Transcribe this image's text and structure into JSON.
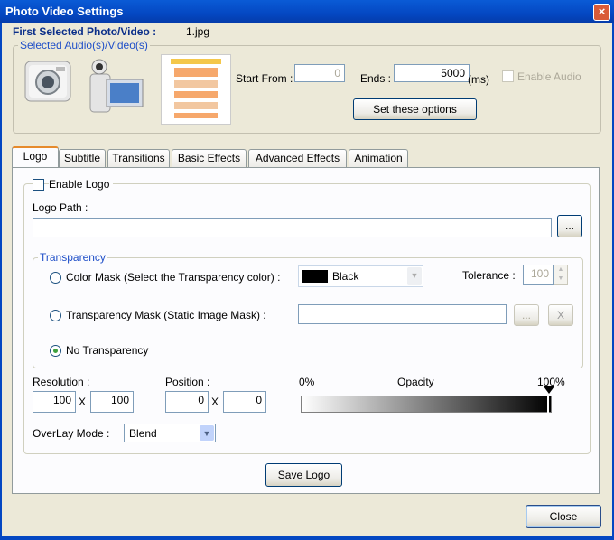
{
  "window": {
    "title": "Photo Video Settings"
  },
  "header": {
    "first_selected_label": "First Selected Photo/Video :",
    "first_selected_value": "1.jpg",
    "selected_group_label": "Selected Audio(s)/Video(s)",
    "start_from_label": "Start From :",
    "start_from_value": "0",
    "ends_label": "Ends :",
    "ends_value": "5000",
    "ends_unit": "(ms)",
    "enable_audio_label": "Enable Audio",
    "set_options_label": "Set these options"
  },
  "tabs": [
    {
      "label": "Logo"
    },
    {
      "label": "Subtitle"
    },
    {
      "label": "Transitions"
    },
    {
      "label": "Basic Effects"
    },
    {
      "label": "Advanced Effects"
    },
    {
      "label": "Animation"
    }
  ],
  "logo": {
    "enable_logo_label": "Enable Logo",
    "logo_path_label": "Logo Path :",
    "logo_path_value": "",
    "browse_label": "...",
    "transparency_label": "Transparency",
    "color_mask_label": "Color Mask (Select the Transparency color) :",
    "color_value": "Black",
    "tolerance_label": "Tolerance :",
    "tolerance_value": "100",
    "transparency_mask_label": "Transparency Mask (Static Image Mask) :",
    "mask_path_value": "",
    "mask_browse_label": "...",
    "mask_clear_label": "X",
    "no_transparency_label": "No Transparency",
    "resolution_label": "Resolution :",
    "res_w": "100",
    "res_h": "100",
    "x_sep": "X",
    "position_label": "Position :",
    "pos_x": "0",
    "pos_y": "0",
    "opacity_min": "0%",
    "opacity_label": "Opacity",
    "opacity_max": "100%",
    "opacity_value": 1.0,
    "overlay_label": "OverLay Mode :",
    "overlay_value": "Blend",
    "save_label": "Save Logo"
  },
  "footer": {
    "close_label": "Close"
  }
}
